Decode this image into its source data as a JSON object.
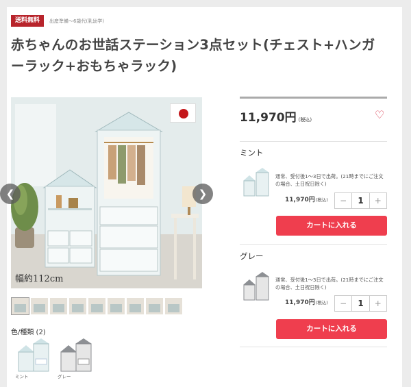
{
  "header": {
    "badge": "送料無料",
    "badge_note": "出産準備〜6歳代(乳幼学)",
    "title": "赤ちゃんのお世話ステーション3点セット(チェスト+ハンガーラック+おもちゃラック)"
  },
  "gallery": {
    "size_label": "幅約112cm",
    "thumb_count": 10,
    "variants_title": "色/種類 (2)",
    "variants": [
      {
        "caption": "ミント"
      },
      {
        "caption": "グレー"
      }
    ]
  },
  "price": {
    "amount": "11,970円",
    "tax": "(税込)"
  },
  "variants": [
    {
      "name": "ミント",
      "ship_note": "通常、受付後1〜3日で出荷。(21時までにご注文の場合、土日祝日除く)",
      "unit_price": "11,970円",
      "unit_tax": "(税込)",
      "qty": "1",
      "cart_label": "カートに入れる"
    },
    {
      "name": "グレー",
      "ship_note": "通常、受付後1〜3日で出荷。(21時までにご注文の場合、土日祝日除く)",
      "unit_price": "11,970円",
      "unit_tax": "(税込)",
      "qty": "1",
      "cart_label": "カートに入れる"
    }
  ],
  "colors": {
    "badge": "#b8242b",
    "cart_button": "#ef3e4e",
    "heart": "#d9354b",
    "mint": "#d4e6e8",
    "gray": "#8a8c90"
  },
  "icons": {
    "heart": "heart-outline-icon",
    "prev": "chevron-left-icon",
    "next": "chevron-right-icon",
    "minus": "minus-icon",
    "plus": "plus-icon"
  }
}
